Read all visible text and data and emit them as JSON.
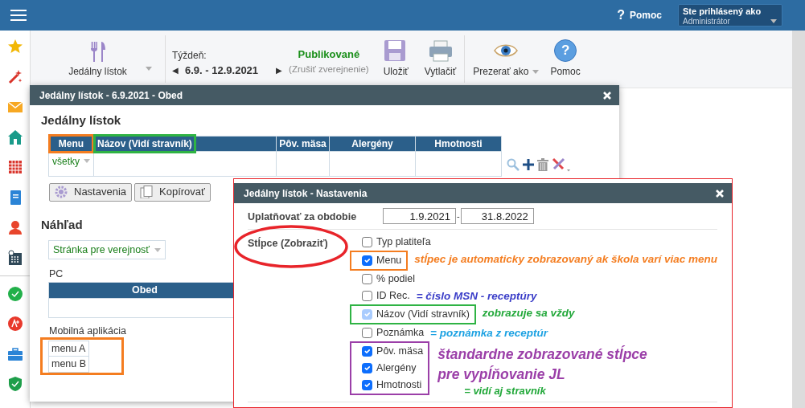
{
  "topbar": {
    "help_mark": "?",
    "help": "Pomoc",
    "user_label": "Ste prihlásený ako",
    "user_value": "Administrátor"
  },
  "toolbar": {
    "menu_select": "Jedálny lístok",
    "week_label": "Týždeň:",
    "prev": "◀",
    "range": "6.9. - 12.9.2021",
    "next": "▶",
    "status": "Publikované",
    "status_action": "(Zrušiť zverejnenie)",
    "buttons": [
      {
        "kind": "save",
        "label": "Uložiť",
        "dropdown": false
      },
      {
        "kind": "print",
        "label": "Vytlačiť",
        "dropdown": false
      },
      {
        "kind": "view",
        "label": "Prezerať ako",
        "dropdown": true
      },
      {
        "kind": "help",
        "label": "Pomoc",
        "dropdown": false,
        "icon_text": "?"
      }
    ]
  },
  "menu_window": {
    "title": "Jedálny lístok - 6.9.2021 - Obed",
    "heading": "Jedálny lístok",
    "columns": [
      {
        "label": "Menu",
        "highlight": {
          "color": "#f47d20"
        }
      },
      {
        "label": "Názov (Vidí stravník)",
        "highlight": {
          "color": "#2fb344"
        }
      },
      {
        "label": "Pôv. mäsa"
      },
      {
        "label": "Alergény"
      },
      {
        "label": "Hmotnosti"
      }
    ],
    "filter": "všetky",
    "buttons": [
      {
        "kind": "settings",
        "label": "Nastavenia"
      },
      {
        "kind": "copy",
        "label": "Kopírovať"
      }
    ],
    "preview_heading": "Náhľad",
    "preview_select": "Stránka pre verejnosť",
    "pc_label": "PC",
    "pc_columns": [
      "Obed"
    ],
    "mobile_label": "Mobilná aplikácia",
    "mobile_highlight": {
      "color": "#f47d20"
    },
    "mobile_items": [
      "menu A",
      "menu B"
    ]
  },
  "settings_window": {
    "title": "Jedálny lístok - Nastavenia",
    "highlight": {
      "color": "#e8242a"
    },
    "period_label": "Uplatňovať za obdobie",
    "date_from": "1.9.2021",
    "date_separator": "-",
    "date_to": "31.8.2022",
    "columns_label": "Stĺpce (Zobraziť)",
    "columns_label_highlight": {
      "color": "#e8242a"
    },
    "groups": [
      {
        "items": [
          {
            "label": "Typ platiteľa",
            "checked": false,
            "disabled": false
          }
        ]
      },
      {
        "highlight": {
          "color": "#f47d20"
        },
        "items": [
          {
            "label": "Menu",
            "checked": true,
            "disabled": false
          }
        ],
        "notes": [
          {
            "text": "stĺpec je automaticky zobrazovaný ak škola varí viac menu",
            "color": "#f47d20"
          }
        ]
      },
      {
        "items": [
          {
            "label": "% podiel",
            "checked": false,
            "disabled": false
          }
        ]
      },
      {
        "items": [
          {
            "label": "ID Rec.",
            "checked": false,
            "disabled": false
          }
        ],
        "notes": [
          {
            "text": "= číslo MSN - receptúry",
            "color": "#3a3dc8"
          }
        ]
      },
      {
        "highlight": {
          "color": "#2fb344"
        },
        "items": [
          {
            "label": "Názov (Vidí stravník)",
            "checked": true,
            "disabled": true
          }
        ],
        "notes": [
          {
            "text": "zobrazuje sa vždy",
            "color": "#22a83a"
          }
        ]
      },
      {
        "items": [
          {
            "label": "Poznámka",
            "checked": false,
            "disabled": false
          }
        ],
        "notes": [
          {
            "text": "= poznámka z receptúr",
            "color": "#1ba1e2"
          }
        ]
      },
      {
        "highlight": {
          "color": "#9b3fa8"
        },
        "items": [
          {
            "label": "Pôv. mäsa",
            "checked": true,
            "disabled": false
          },
          {
            "label": "Alergény",
            "checked": true,
            "disabled": false
          },
          {
            "label": "Hmotnosti",
            "checked": true,
            "disabled": false
          }
        ],
        "notes": [
          {
            "text": "štandardne zobrazované stĺpce",
            "color": "#9b3fa8"
          },
          {
            "text": "pre vypĺňovanie JL",
            "color": "#9b3fa8"
          },
          {
            "text": "= vidí aj stravník",
            "color": "#22a83a"
          }
        ]
      }
    ]
  }
}
